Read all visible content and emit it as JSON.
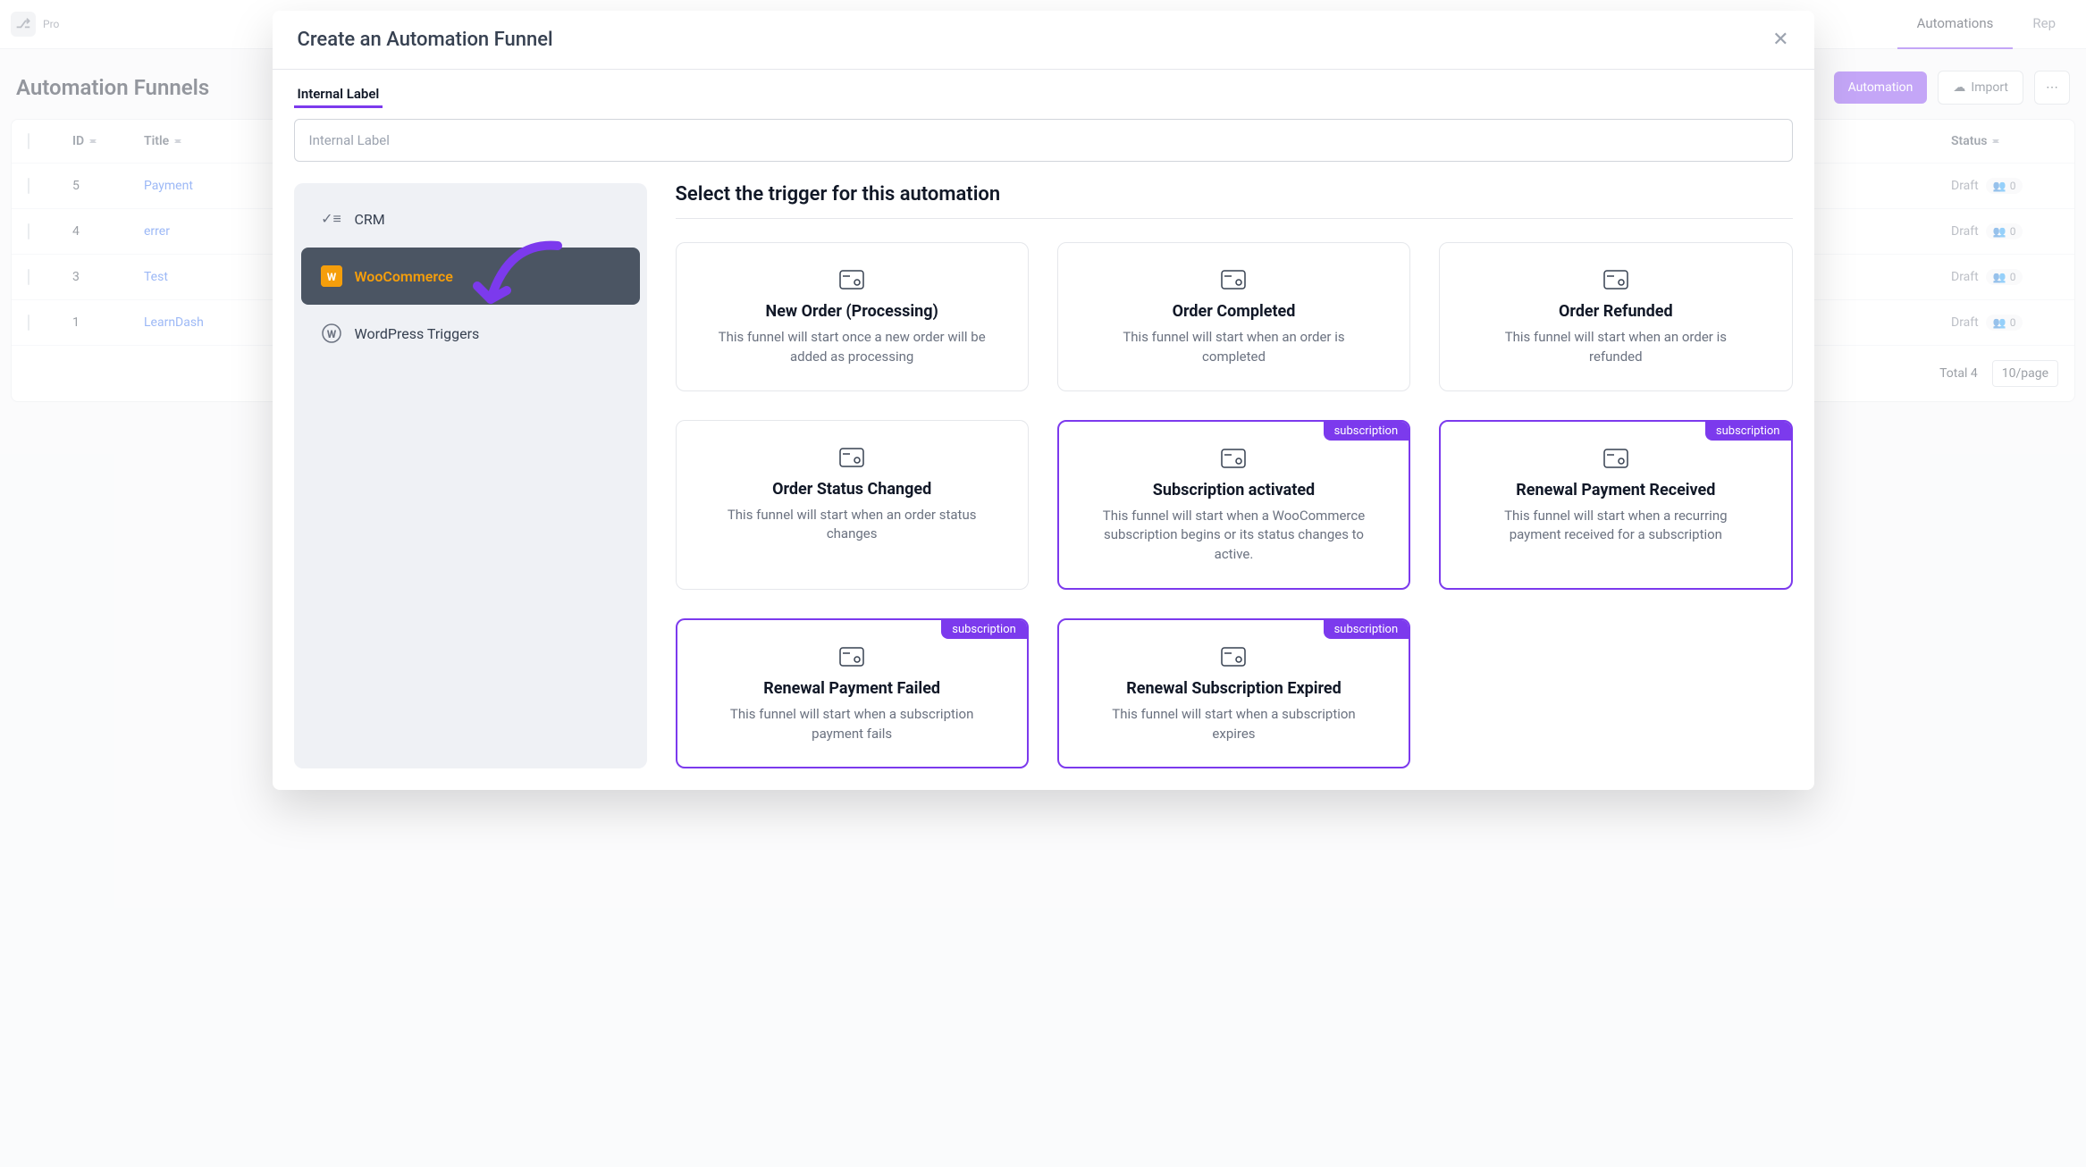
{
  "topbar": {
    "pro": "Pro",
    "nav": [
      "Automations",
      "Rep"
    ]
  },
  "page": {
    "title": "Automation Funnels",
    "automation_btn": "Automation",
    "import_btn": "Import"
  },
  "table": {
    "headers": {
      "id": "ID",
      "title": "Title",
      "status": "Status"
    },
    "rows": [
      {
        "id": "5",
        "title": "Payment",
        "status": "Draft",
        "count": "0"
      },
      {
        "id": "4",
        "title": "errer",
        "status": "Draft",
        "count": "0"
      },
      {
        "id": "3",
        "title": "Test",
        "status": "Draft",
        "count": "0"
      },
      {
        "id": "1",
        "title": "LearnDash",
        "status": "Draft",
        "count": "0"
      }
    ],
    "total_label": "Total 4",
    "perpage": "10/page"
  },
  "modal": {
    "title": "Create an Automation Funnel",
    "label": "Internal Label",
    "placeholder": "Internal Label",
    "section": "Select the trigger for this automation",
    "sidebar": [
      {
        "label": "CRM"
      },
      {
        "label": "WooCommerce"
      },
      {
        "label": "WordPress Triggers"
      }
    ],
    "badge": "subscription",
    "cards": [
      {
        "title": "New Order (Processing)",
        "desc": "This funnel will start once a new order will be added as processing"
      },
      {
        "title": "Order Completed",
        "desc": "This funnel will start when an order is completed"
      },
      {
        "title": "Order Refunded",
        "desc": "This funnel will start when an order is refunded"
      },
      {
        "title": "Order Status Changed",
        "desc": "This funnel will start when an order status changes"
      },
      {
        "title": "Subscription activated",
        "desc": "This funnel will start when a WooCommerce subscription begins or its status changes to active."
      },
      {
        "title": "Renewal Payment Received",
        "desc": "This funnel will start when a recurring payment received for a subscription"
      },
      {
        "title": "Renewal Payment Failed",
        "desc": "This funnel will start when a subscription payment fails"
      },
      {
        "title": "Renewal Subscription Expired",
        "desc": "This funnel will start when a subscription expires"
      }
    ]
  }
}
